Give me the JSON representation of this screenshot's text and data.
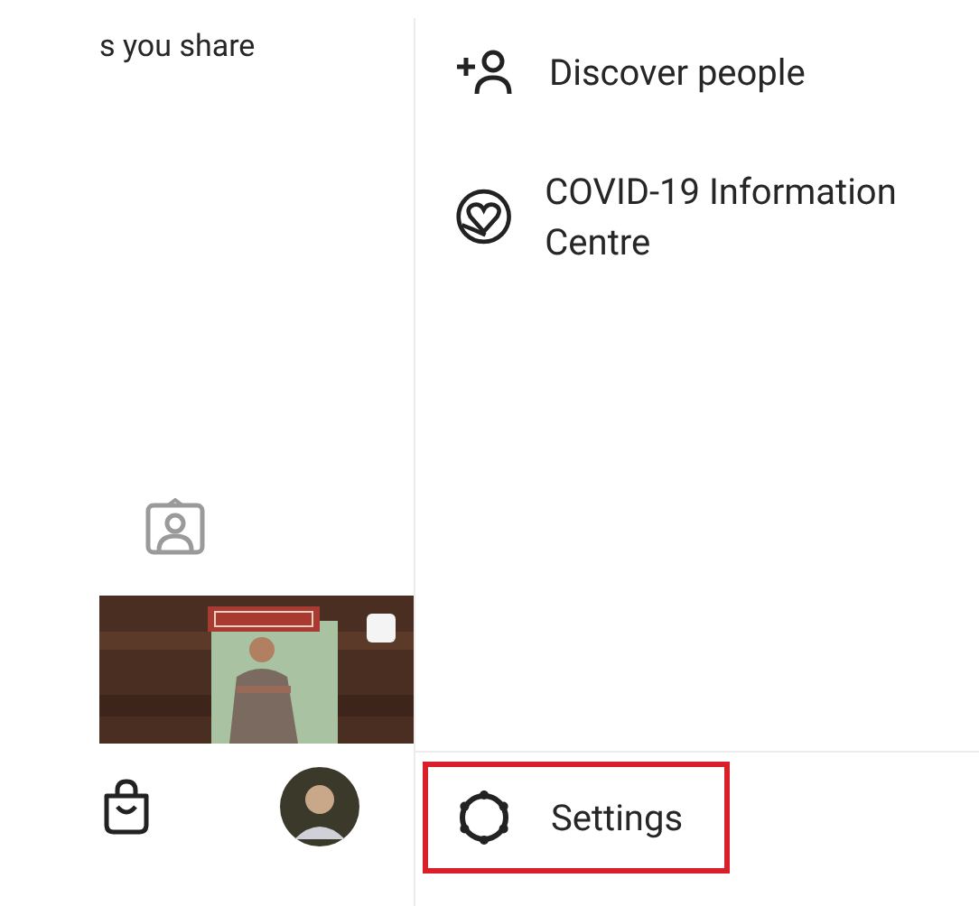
{
  "profile_panel": {
    "caption": "s you share"
  },
  "menu_items": [
    {
      "kind": "add-person",
      "label": "Discover people"
    },
    {
      "kind": "heart-circle",
      "label": "COVID-19 Information Centre"
    }
  ],
  "settings": {
    "label": "Settings",
    "highlighted": true
  }
}
